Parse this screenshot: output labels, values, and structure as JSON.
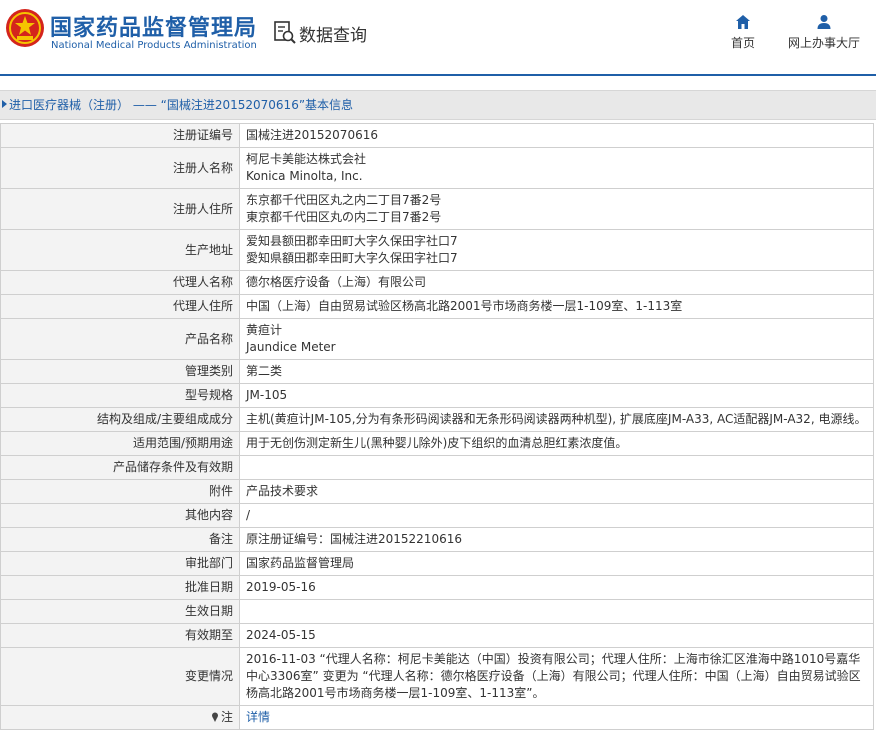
{
  "header": {
    "brand_cn": "国家药品监督管理局",
    "brand_en": "National Medical Products Administration",
    "search_label": "数据查询",
    "nav": [
      {
        "label": "首页",
        "icon": "home-icon"
      },
      {
        "label": "网上办事大厅",
        "icon": "user-icon"
      }
    ]
  },
  "breadcrumb": {
    "text": "进口医疗器械（注册） —— “国械注进20152070616”基本信息"
  },
  "rows": [
    {
      "label": "注册证编号",
      "value": "国械注进20152070616"
    },
    {
      "label": "注册人名称",
      "value": "柯尼卡美能达株式会社\nKonica Minolta, Inc."
    },
    {
      "label": "注册人住所",
      "value": "东京都千代田区丸之内二丁目7番2号\n東京都千代田区丸の内二丁目7番2号"
    },
    {
      "label": "生产地址",
      "value": "爱知县额田郡幸田町大字久保田字社口7\n愛知県額田郡幸田町大字久保田字社口7"
    },
    {
      "label": "代理人名称",
      "value": "德尔格医疗设备（上海）有限公司"
    },
    {
      "label": "代理人住所",
      "value": "中国（上海）自由贸易试验区杨高北路2001号市场商务楼一层1-109室、1-113室"
    },
    {
      "label": "产品名称",
      "value": "黄疸计\nJaundice Meter"
    },
    {
      "label": "管理类别",
      "value": "第二类"
    },
    {
      "label": "型号规格",
      "value": "JM-105"
    },
    {
      "label": "结构及组成/主要组成成分",
      "value": "主机(黄疸计JM-105,分为有条形码阅读器和无条形码阅读器两种机型), 扩展底座JM-A33, AC适配器JM-A32, 电源线。"
    },
    {
      "label": "适用范围/预期用途",
      "value": "用于无创伤测定新生儿(黑种婴儿除外)皮下组织的血清总胆红素浓度值。"
    },
    {
      "label": "产品储存条件及有效期",
      "value": ""
    },
    {
      "label": "附件",
      "value": "产品技术要求"
    },
    {
      "label": "其他内容",
      "value": "/"
    },
    {
      "label": "备注",
      "value": "原注册证编号：国械注进20152210616"
    },
    {
      "label": "审批部门",
      "value": "国家药品监督管理局"
    },
    {
      "label": "批准日期",
      "value": "2019-05-16"
    },
    {
      "label": "生效日期",
      "value": ""
    },
    {
      "label": "有效期至",
      "value": "2024-05-15"
    },
    {
      "label": "变更情况",
      "value": "2016-11-03 “代理人名称：柯尼卡美能达（中国）投资有限公司；代理人住所：上海市徐汇区淮海中路1010号嘉华中心3306室” 变更为 “代理人名称：德尔格医疗设备（上海）有限公司；代理人住所：中国（上海）自由贸易试验区杨高北路2001号市场商务楼一层1-109室、1-113室”。"
    }
  ],
  "note_row": {
    "label": "注",
    "link": "详情",
    "icon": "pin-icon"
  }
}
